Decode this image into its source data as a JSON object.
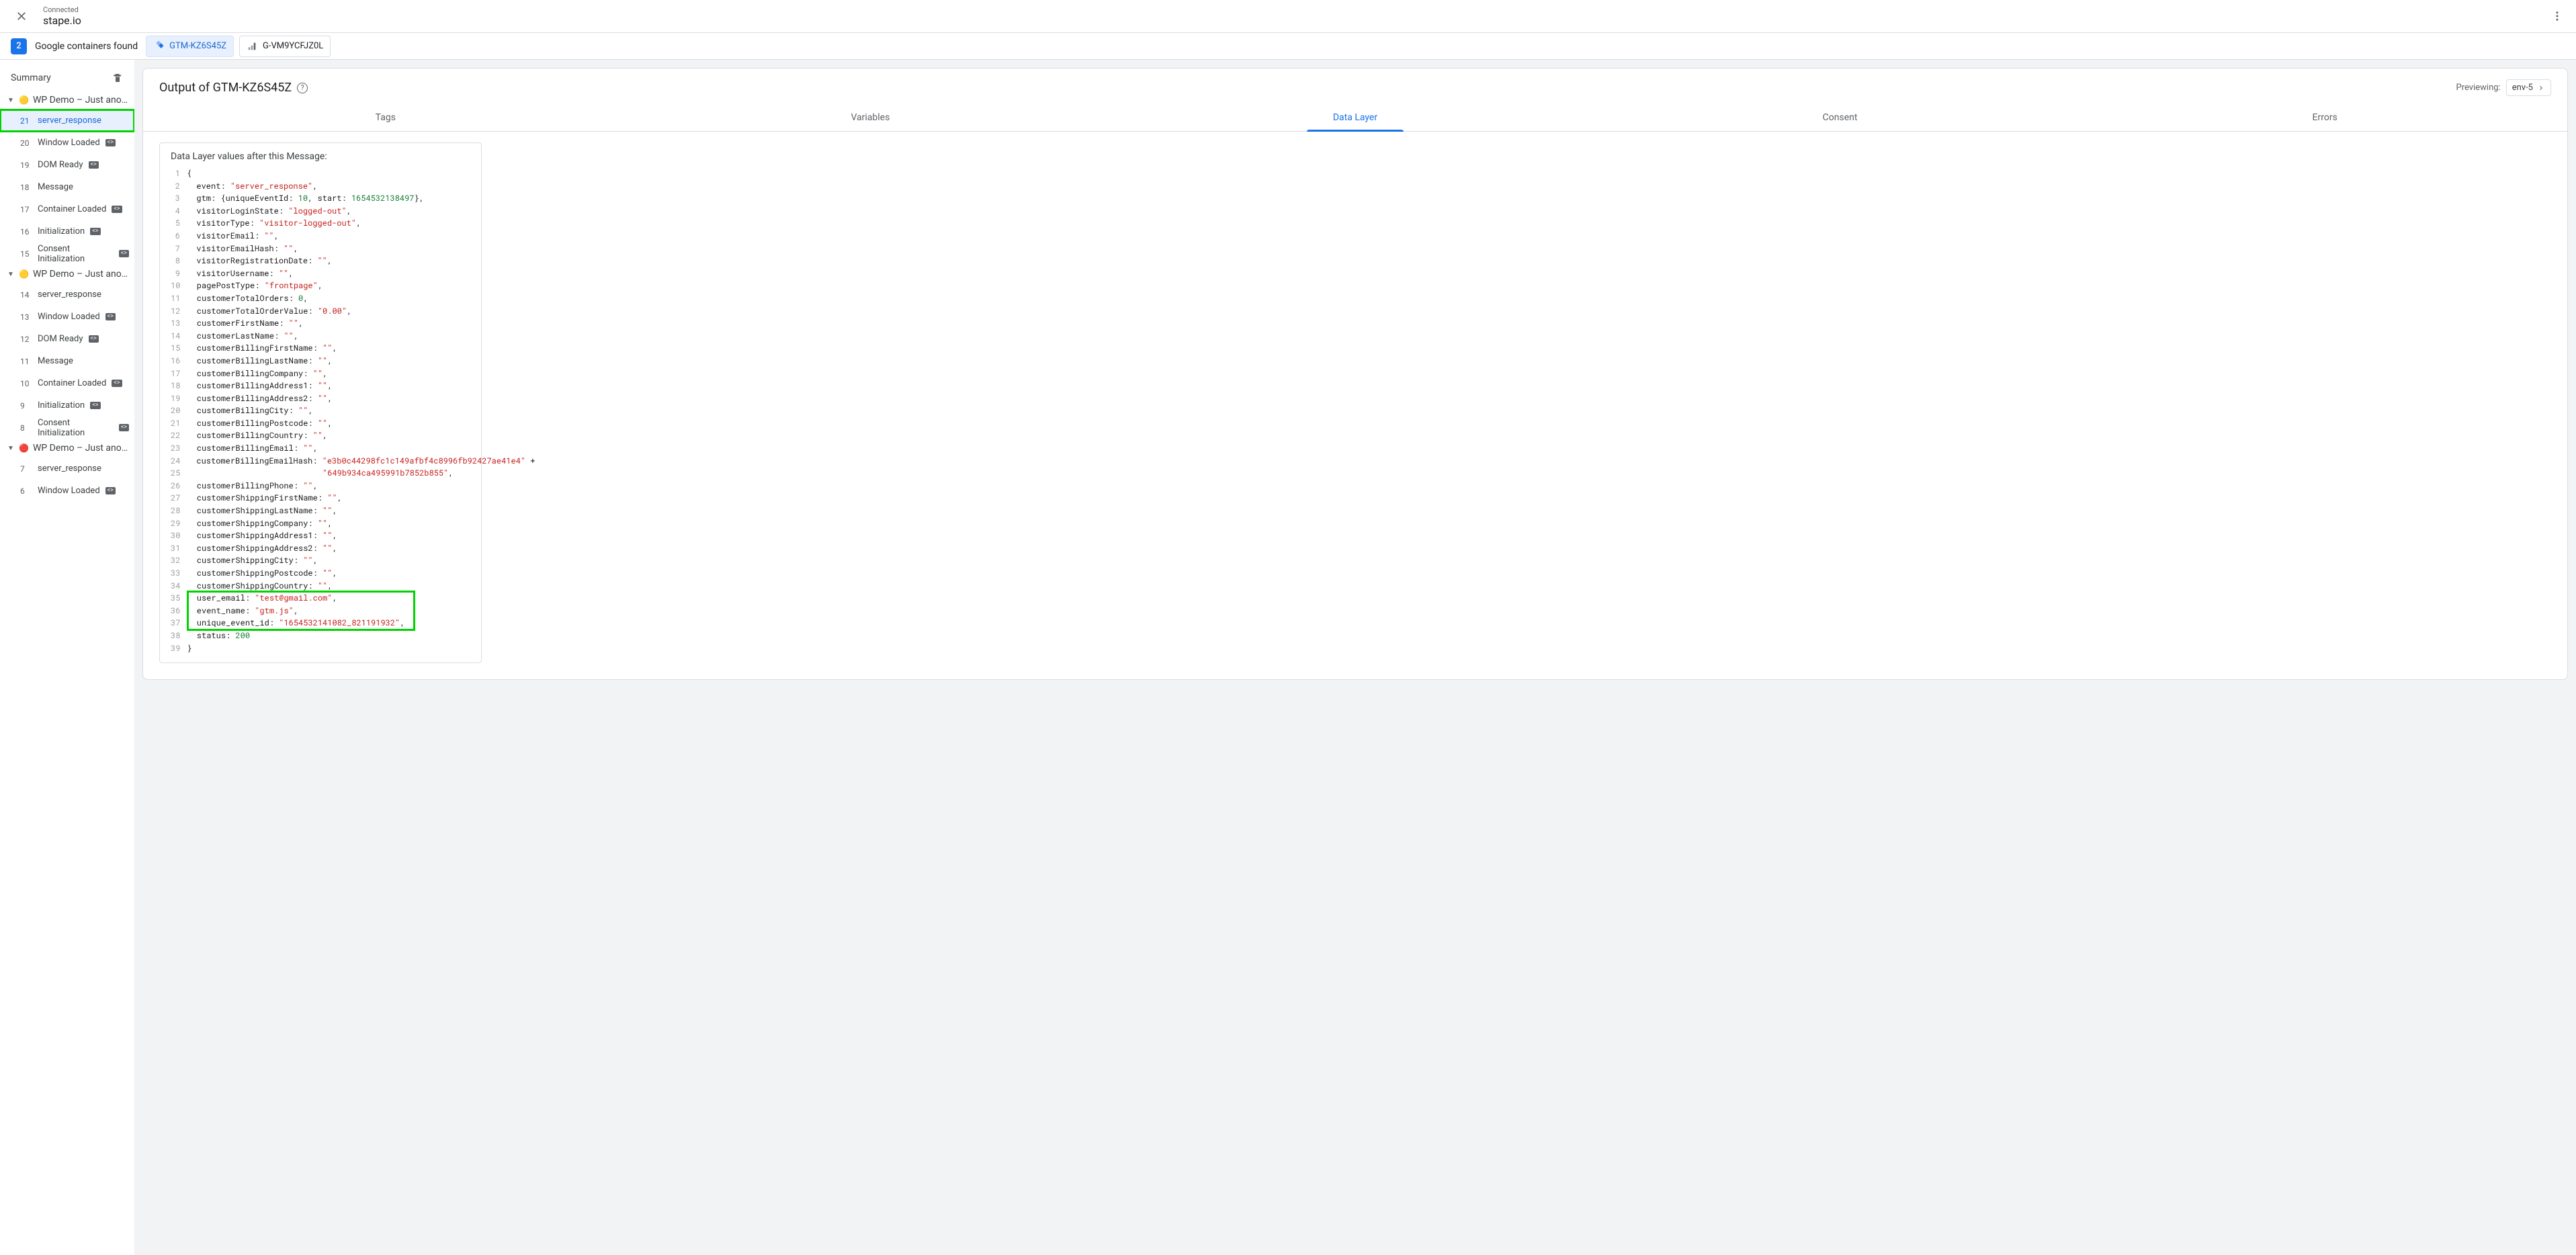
{
  "header": {
    "connected": "Connected",
    "domain": "stape.io"
  },
  "subbar": {
    "count": "2",
    "label": "Google containers found",
    "chips": [
      {
        "id": "GTM-KZ6S45Z",
        "active": true,
        "icon": "gtm"
      },
      {
        "id": "G-VM9YCFJZ0L",
        "active": false,
        "icon": "analytics"
      }
    ]
  },
  "sidebar": {
    "summary": "Summary",
    "groups": [
      {
        "status": "🟡",
        "label": "WP Demo – Just anothe...",
        "items": [
          {
            "num": "21",
            "name": "server_response",
            "selected": true,
            "highlighted": true
          },
          {
            "num": "20",
            "name": "Window Loaded",
            "tag": true
          },
          {
            "num": "19",
            "name": "DOM Ready",
            "tag": true
          },
          {
            "num": "18",
            "name": "Message"
          },
          {
            "num": "17",
            "name": "Container Loaded",
            "tag": true
          },
          {
            "num": "16",
            "name": "Initialization",
            "tag": true
          },
          {
            "num": "15",
            "name": "Consent Initialization",
            "tag": true
          }
        ]
      },
      {
        "status": "🟡",
        "label": "WP Demo – Just anothe...",
        "items": [
          {
            "num": "14",
            "name": "server_response"
          },
          {
            "num": "13",
            "name": "Window Loaded",
            "tag": true
          },
          {
            "num": "12",
            "name": "DOM Ready",
            "tag": true
          },
          {
            "num": "11",
            "name": "Message"
          },
          {
            "num": "10",
            "name": "Container Loaded",
            "tag": true
          },
          {
            "num": "9",
            "name": "Initialization",
            "tag": true
          },
          {
            "num": "8",
            "name": "Consent Initialization",
            "tag": true
          }
        ]
      },
      {
        "status": "🔴",
        "label": "WP Demo – Just anothe...",
        "items": [
          {
            "num": "7",
            "name": "server_response"
          },
          {
            "num": "6",
            "name": "Window Loaded",
            "tag": true
          }
        ]
      }
    ]
  },
  "panel": {
    "title": "Output of GTM-KZ6S45Z",
    "previewing": "Previewing:",
    "env": "env-5",
    "tabs": [
      "Tags",
      "Variables",
      "Data Layer",
      "Consent",
      "Errors"
    ],
    "activeTab": 2,
    "card_title": "Data Layer values after this Message:",
    "code": [
      [
        {
          "t": "{"
        }
      ],
      [
        {
          "t": "  event: "
        },
        {
          "t": "\"server_response\"",
          "c": "s"
        },
        {
          "t": ","
        }
      ],
      [
        {
          "t": "  gtm: {uniqueEventId: "
        },
        {
          "t": "10",
          "c": "n"
        },
        {
          "t": ", start: "
        },
        {
          "t": "1654532138497",
          "c": "n"
        },
        {
          "t": "},"
        }
      ],
      [
        {
          "t": "  visitorLoginState: "
        },
        {
          "t": "\"logged-out\"",
          "c": "s"
        },
        {
          "t": ","
        }
      ],
      [
        {
          "t": "  visitorType: "
        },
        {
          "t": "\"visitor-logged-out\"",
          "c": "s"
        },
        {
          "t": ","
        }
      ],
      [
        {
          "t": "  visitorEmail: "
        },
        {
          "t": "\"\"",
          "c": "s"
        },
        {
          "t": ","
        }
      ],
      [
        {
          "t": "  visitorEmailHash: "
        },
        {
          "t": "\"\"",
          "c": "s"
        },
        {
          "t": ","
        }
      ],
      [
        {
          "t": "  visitorRegistrationDate: "
        },
        {
          "t": "\"\"",
          "c": "s"
        },
        {
          "t": ","
        }
      ],
      [
        {
          "t": "  visitorUsername: "
        },
        {
          "t": "\"\"",
          "c": "s"
        },
        {
          "t": ","
        }
      ],
      [
        {
          "t": "  pagePostType: "
        },
        {
          "t": "\"frontpage\"",
          "c": "s"
        },
        {
          "t": ","
        }
      ],
      [
        {
          "t": "  customerTotalOrders: "
        },
        {
          "t": "0",
          "c": "n"
        },
        {
          "t": ","
        }
      ],
      [
        {
          "t": "  customerTotalOrderValue: "
        },
        {
          "t": "\"0.00\"",
          "c": "s"
        },
        {
          "t": ","
        }
      ],
      [
        {
          "t": "  customerFirstName: "
        },
        {
          "t": "\"\"",
          "c": "s"
        },
        {
          "t": ","
        }
      ],
      [
        {
          "t": "  customerLastName: "
        },
        {
          "t": "\"\"",
          "c": "s"
        },
        {
          "t": ","
        }
      ],
      [
        {
          "t": "  customerBillingFirstName: "
        },
        {
          "t": "\"\"",
          "c": "s"
        },
        {
          "t": ","
        }
      ],
      [
        {
          "t": "  customerBillingLastName: "
        },
        {
          "t": "\"\"",
          "c": "s"
        },
        {
          "t": ","
        }
      ],
      [
        {
          "t": "  customerBillingCompany: "
        },
        {
          "t": "\"\"",
          "c": "s"
        },
        {
          "t": ","
        }
      ],
      [
        {
          "t": "  customerBillingAddress1: "
        },
        {
          "t": "\"\"",
          "c": "s"
        },
        {
          "t": ","
        }
      ],
      [
        {
          "t": "  customerBillingAddress2: "
        },
        {
          "t": "\"\"",
          "c": "s"
        },
        {
          "t": ","
        }
      ],
      [
        {
          "t": "  customerBillingCity: "
        },
        {
          "t": "\"\"",
          "c": "s"
        },
        {
          "t": ","
        }
      ],
      [
        {
          "t": "  customerBillingPostcode: "
        },
        {
          "t": "\"\"",
          "c": "s"
        },
        {
          "t": ","
        }
      ],
      [
        {
          "t": "  customerBillingCountry: "
        },
        {
          "t": "\"\"",
          "c": "s"
        },
        {
          "t": ","
        }
      ],
      [
        {
          "t": "  customerBillingEmail: "
        },
        {
          "t": "\"\"",
          "c": "s"
        },
        {
          "t": ","
        }
      ],
      [
        {
          "t": "  customerBillingEmailHash: "
        },
        {
          "t": "\"e3b0c44298fc1c149afbf4c8996fb92427ae41e4\"",
          "c": "s"
        },
        {
          "t": " +"
        }
      ],
      [
        {
          "t": "                            "
        },
        {
          "t": "\"649b934ca495991b7852b855\"",
          "c": "s"
        },
        {
          "t": ","
        }
      ],
      [
        {
          "t": "  customerBillingPhone: "
        },
        {
          "t": "\"\"",
          "c": "s"
        },
        {
          "t": ","
        }
      ],
      [
        {
          "t": "  customerShippingFirstName: "
        },
        {
          "t": "\"\"",
          "c": "s"
        },
        {
          "t": ","
        }
      ],
      [
        {
          "t": "  customerShippingLastName: "
        },
        {
          "t": "\"\"",
          "c": "s"
        },
        {
          "t": ","
        }
      ],
      [
        {
          "t": "  customerShippingCompany: "
        },
        {
          "t": "\"\"",
          "c": "s"
        },
        {
          "t": ","
        }
      ],
      [
        {
          "t": "  customerShippingAddress1: "
        },
        {
          "t": "\"\"",
          "c": "s"
        },
        {
          "t": ","
        }
      ],
      [
        {
          "t": "  customerShippingAddress2: "
        },
        {
          "t": "\"\"",
          "c": "s"
        },
        {
          "t": ","
        }
      ],
      [
        {
          "t": "  customerShippingCity: "
        },
        {
          "t": "\"\"",
          "c": "s"
        },
        {
          "t": ","
        }
      ],
      [
        {
          "t": "  customerShippingPostcode: "
        },
        {
          "t": "\"\"",
          "c": "s"
        },
        {
          "t": ","
        }
      ],
      [
        {
          "t": "  customerShippingCountry: "
        },
        {
          "t": "\"\"",
          "c": "s"
        },
        {
          "t": ","
        }
      ],
      [
        {
          "t": "  user_email: "
        },
        {
          "t": "\"test@gmail.com\"",
          "c": "s"
        },
        {
          "t": ","
        }
      ],
      [
        {
          "t": "  event_name: "
        },
        {
          "t": "\"gtm.js\"",
          "c": "s"
        },
        {
          "t": ","
        }
      ],
      [
        {
          "t": "  unique_event_id: "
        },
        {
          "t": "\"1654532141082_821191932\"",
          "c": "s"
        },
        {
          "t": ","
        }
      ],
      [
        {
          "t": "  status: "
        },
        {
          "t": "200",
          "c": "n"
        }
      ],
      [
        {
          "t": "}"
        }
      ]
    ],
    "highlight_lines": [
      35,
      36,
      37
    ]
  }
}
